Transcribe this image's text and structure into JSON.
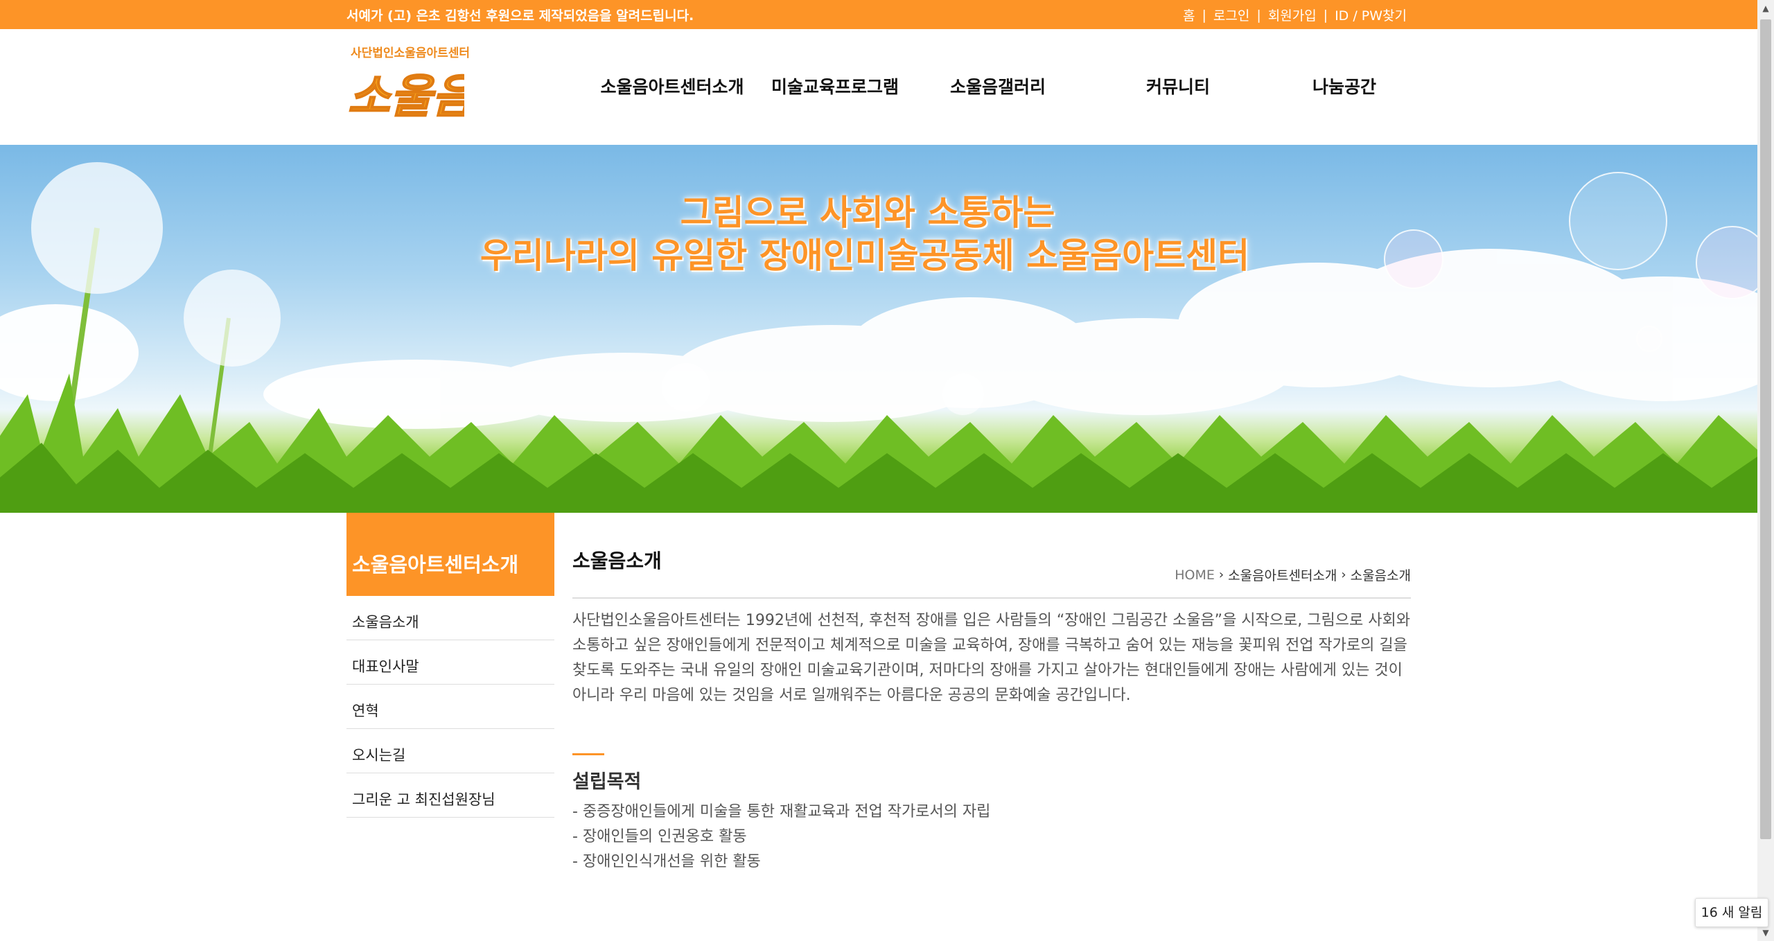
{
  "topbar": {
    "notice": "서예가 (고) 은초 김항선 후원으로 제작되었음을 알려드립니다.",
    "util": [
      "홈",
      "로그인",
      "회원가입",
      "ID / PW찾기"
    ]
  },
  "header": {
    "logo_sub": "사단법인소울음아트센터",
    "logo_text": "소울음",
    "nav": [
      "소울음아트센터소개",
      "미술교육프로그램",
      "소울음갤러리",
      "커뮤니티",
      "나눔공간"
    ]
  },
  "hero": {
    "line1": "그림으로 사회와 소통하는",
    "line2": "우리나라의 유일한 장애인미술공동체 소울음아트센터"
  },
  "lnb": {
    "title": "소울음아트센터소개",
    "items": [
      "소울음소개",
      "대표인사말",
      "연혁",
      "오시는길",
      "그리운 고 최진섭원장님"
    ]
  },
  "content": {
    "title": "소울음소개",
    "breadcrumb": [
      "HOME",
      "소울음아트센터소개",
      "소울음소개"
    ],
    "intro": "사단법인소울음아트센터는 1992년에 선천적, 후천적 장애를 입은 사람들의 “장애인 그림공간 소울음”을 시작으로, 그림으로 사회와 소통하고 싶은 장애인들에게 전문적이고 체계적으로 미술을 교육하여, 장애를 극복하고 숨어 있는 재능을 꽃피워 전업 작가로의 길을 찾도록 도와주는 국내 유일의 장애인 미술교육기관이며, 저마다의 장애를 가지고 살아가는 현대인들에게 장애는 사람에게 있는 것이 아니라 우리 마음에 있는 것임을 서로 일깨워주는 아름다운 공공의 문화예술 공간입니다.",
    "section_title": "설립목적",
    "purposes": [
      "- 중증장애인들에게 미술을 통한 재활교육과 전업 작가로서의 자립",
      "- 장애인들의 인권옹호 활동",
      "- 장애인인식개선을 위한 활동"
    ]
  },
  "notification": "16 새 알림",
  "colors": {
    "brand": "#fd9427",
    "text": "#333333",
    "muted": "#555555"
  }
}
